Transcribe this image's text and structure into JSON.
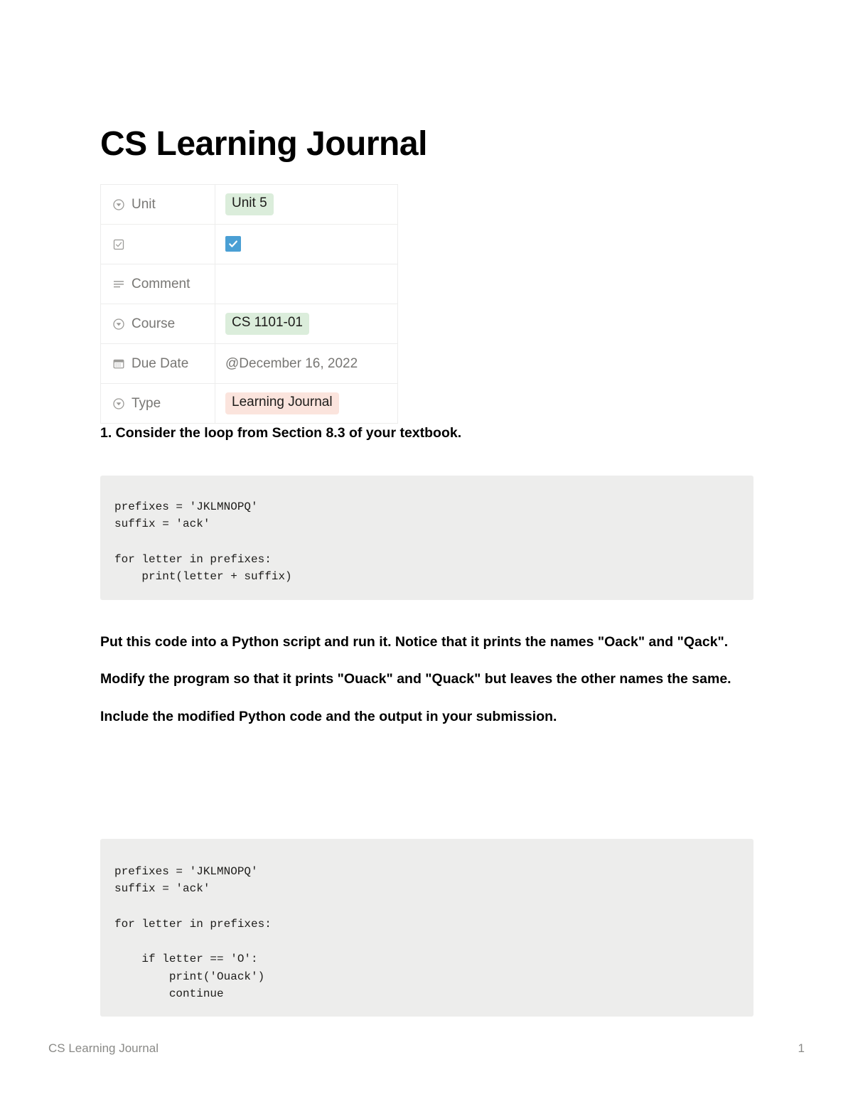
{
  "document": {
    "title": "CS Learning Journal"
  },
  "properties": {
    "rows": [
      {
        "icon": "circle-chevron-down-icon",
        "label": "Unit",
        "value_type": "tag-green",
        "value": "Unit 5"
      },
      {
        "icon": "checkbox-icon",
        "label": "",
        "value_type": "checkbox",
        "value": "checked"
      },
      {
        "icon": "text-lines-icon",
        "label": "Comment",
        "value_type": "empty",
        "value": ""
      },
      {
        "icon": "circle-chevron-down-icon",
        "label": "Course",
        "value_type": "tag-green",
        "value": "CS 1101-01"
      },
      {
        "icon": "calendar-icon",
        "label": "Due Date",
        "value_type": "plain",
        "value": "@December 16, 2022"
      },
      {
        "icon": "circle-chevron-down-icon",
        "label": "Type",
        "value_type": "tag-pink",
        "value": "Learning Journal"
      }
    ]
  },
  "body": {
    "question_heading": "1. Consider the loop from Section 8.3 of your textbook.",
    "code_original": "prefixes = 'JKLMNOPQ'\nsuffix = 'ack'\n\nfor letter in prefixes:\n    print(letter + suffix)",
    "paragraph_1": "Put this code into a Python script and run it. Notice that it prints the names \"Oack\" and \"Qack\".",
    "paragraph_2": "Modify the program so that it prints \"Ouack\" and \"Quack\" but leaves the other names the same.",
    "paragraph_3": "Include the modified Python code and the output in your submission.",
    "code_modified": "prefixes = 'JKLMNOPQ'\nsuffix = 'ack'\n\nfor letter in prefixes:\n\n    if letter == 'O':\n        print('Ouack')\n        continue"
  },
  "footer": {
    "left_text": "CS Learning Journal",
    "page_number": "1"
  },
  "colors": {
    "tag_green_bg": "#dbeddb",
    "tag_pink_bg": "#fbe4dd",
    "checkbox_blue": "#4a9fd4",
    "code_bg": "#ededec",
    "muted_text": "#787774",
    "table_border": "#ededec"
  }
}
